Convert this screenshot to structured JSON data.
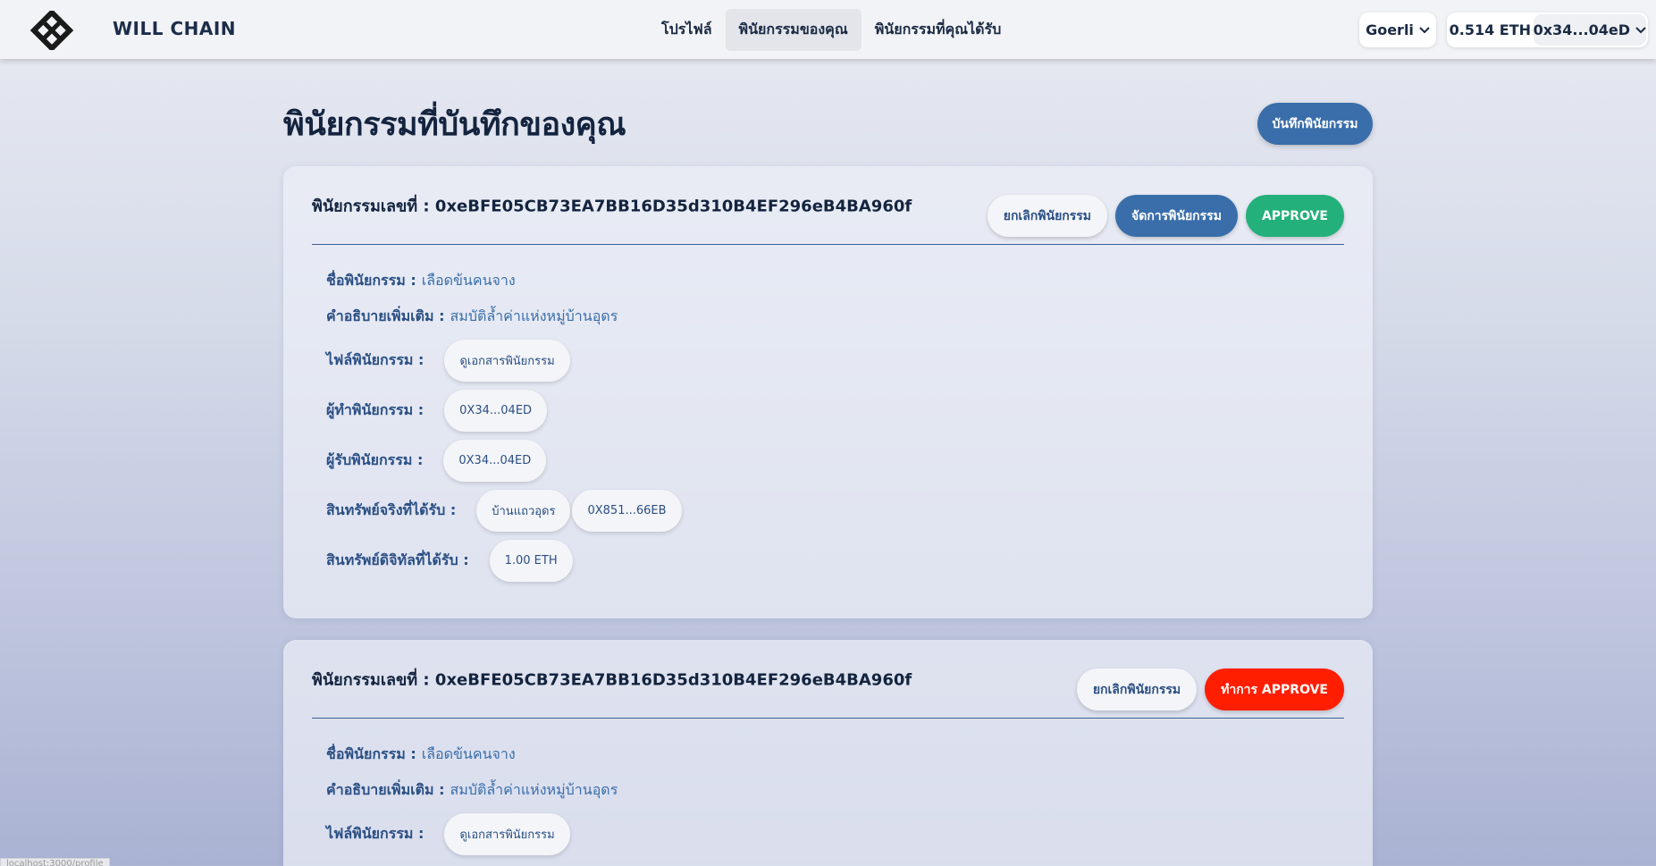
{
  "header": {
    "brand": "WILL CHAIN",
    "nav": [
      {
        "label": "โปรไฟล์"
      },
      {
        "label": "พินัยกรรมของคุณ"
      },
      {
        "label": "พินัยกรรมที่คุณได้รับ"
      }
    ],
    "network": "Goerli",
    "balance": "0.514 ETH",
    "address": "0x34...04eD"
  },
  "page": {
    "title": "พินัยกรรมที่บันทึกของคุณ",
    "record_button": "บันทึกพินัยกรรม"
  },
  "labels": {
    "will_number": "พินัยกรรมเลขที่ :",
    "name": "ชื่อพินัยกรรม :",
    "description": "คำอธิบายเพิ่มเติม :",
    "file": "ไฟล์พินัยกรรม :",
    "testator": "ผู้ทำพินัยกรรม :",
    "beneficiary": "ผู้รับพินัยกรรม :",
    "real_assets": "สินทรัพย์จริงที่ได้รับ :",
    "digital_assets": "สินทรัพย์ดิจิทัลที่ได้รับ :"
  },
  "wills": [
    {
      "id": "0xeBFE05CB73EA7BB16D35d310B4EF296eB4BA960f",
      "actions": {
        "cancel": "ยกเลิกพินัยกรรม",
        "manage": "จัดการพินัยกรรม",
        "approve": "APPROVE"
      },
      "name": "เลือดข้นคนจาง",
      "description": "สมบัติล้ำค่าแห่งหมู่บ้านอุดร",
      "file_button": "ดูเอกสารพินัยกรรม",
      "testator": "0X34...04ED",
      "beneficiary": "0X34...04ED",
      "real_assets": [
        "บ้านแถวอุดร",
        "0X851...66EB"
      ],
      "digital_assets": "1.00 ETH"
    },
    {
      "id": "0xeBFE05CB73EA7BB16D35d310B4EF296eB4BA960f",
      "actions": {
        "cancel": "ยกเลิกพินัยกรรม",
        "approve": "ทำการ APPROVE"
      },
      "name": "เลือดข้นคนจาง",
      "description": "สมบัติล้ำค่าแห่งหมู่บ้านอุดร",
      "file_button": "ดูเอกสารพินัยกรรม"
    }
  ],
  "status_bar_url": "localhost:3000/profile",
  "colors": {
    "primary": "#3a6eaa",
    "approve_green": "#23b07a",
    "approve_red": "#ff1e00",
    "text_dark": "#14243f"
  }
}
